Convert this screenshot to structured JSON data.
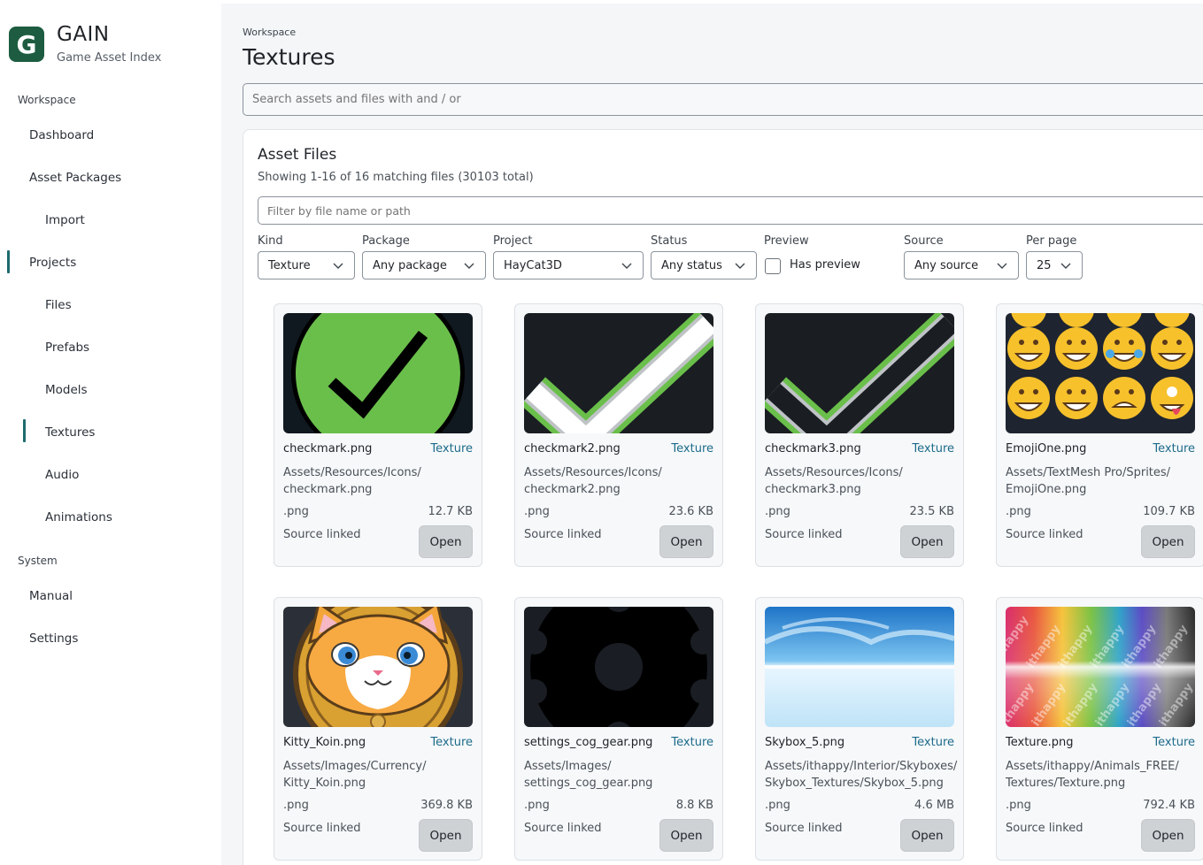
{
  "app": {
    "logo_letter": "G",
    "name": "GAIN",
    "subtitle": "Game Asset Index"
  },
  "sidebar": {
    "sections": [
      "Workspace",
      "System"
    ],
    "items": [
      {
        "label": "Dashboard",
        "active": false
      },
      {
        "label": "Asset Packages",
        "active": false
      },
      {
        "label": "Import",
        "active": false
      },
      {
        "label": "Projects",
        "active": true
      },
      {
        "label": "Files",
        "active": false
      },
      {
        "label": "Prefabs",
        "active": false
      },
      {
        "label": "Models",
        "active": false
      },
      {
        "label": "Textures",
        "active": true
      },
      {
        "label": "Audio",
        "active": false
      },
      {
        "label": "Animations",
        "active": false
      },
      {
        "label": "Manual",
        "active": false
      },
      {
        "label": "Settings",
        "active": false
      }
    ]
  },
  "header": {
    "breadcrumb": "Workspace",
    "title": "Textures",
    "search_placeholder": "Search assets and files with and / or"
  },
  "panel": {
    "title": "Asset Files",
    "summary": "Showing 1-16 of 16 matching files (30103 total)",
    "filter_placeholder": "Filter by file name or path"
  },
  "filters": {
    "kind": {
      "label": "Kind",
      "value": "Texture"
    },
    "package": {
      "label": "Package",
      "value": "Any package"
    },
    "project": {
      "label": "Project",
      "value": "HayCat3D"
    },
    "status": {
      "label": "Status",
      "value": "Any status"
    },
    "preview": {
      "label": "Preview",
      "checkbox_label": "Has preview",
      "checked": false
    },
    "source": {
      "label": "Source",
      "value": "Any source"
    },
    "per_page": {
      "label": "Per page",
      "value": "25"
    }
  },
  "cards": [
    {
      "name": "checkmark.png",
      "kind": "Texture",
      "path": "Assets/Resources/Icons/ checkmark.png",
      "ext": ".png",
      "size": "12.7 KB",
      "source": "Source linked",
      "action": "Open"
    },
    {
      "name": "checkmark2.png",
      "kind": "Texture",
      "path": "Assets/Resources/Icons/ checkmark2.png",
      "ext": ".png",
      "size": "23.6 KB",
      "source": "Source linked",
      "action": "Open"
    },
    {
      "name": "checkmark3.png",
      "kind": "Texture",
      "path": "Assets/Resources/Icons/ checkmark3.png",
      "ext": ".png",
      "size": "23.5 KB",
      "source": "Source linked",
      "action": "Open"
    },
    {
      "name": "EmojiOne.png",
      "kind": "Texture",
      "path": "Assets/TextMesh Pro/Sprites/ EmojiOne.png",
      "ext": ".png",
      "size": "109.7 KB",
      "source": "Source linked",
      "action": "Open"
    },
    {
      "name": "Kitty_Koin.png",
      "kind": "Texture",
      "path": "Assets/Images/Currency/ Kitty_Koin.png",
      "ext": ".png",
      "size": "369.8 KB",
      "source": "Source linked",
      "action": "Open"
    },
    {
      "name": "settings_cog_gear.png",
      "kind": "Texture",
      "path": "Assets/Images/ settings_cog_gear.png",
      "ext": ".png",
      "size": "8.8 KB",
      "source": "Source linked",
      "action": "Open"
    },
    {
      "name": "Skybox_5.png",
      "kind": "Texture",
      "path": "Assets/ithappy/Interior/Skyboxes/ Skybox_Textures/Skybox_5.png",
      "ext": ".png",
      "size": "4.6 MB",
      "source": "Source linked",
      "action": "Open"
    },
    {
      "name": "Texture.png",
      "kind": "Texture",
      "path": "Assets/ithappy/Animals_FREE/ Textures/Texture.png",
      "ext": ".png",
      "size": "792.4 KB",
      "source": "Source linked",
      "action": "Open"
    }
  ],
  "colors": {
    "brand": "#1d5c40",
    "accent": "#1d6b8a",
    "active_marker": "#1d6b6e",
    "check_green": "#6abf4b"
  },
  "texture_watermark": "ithappy"
}
